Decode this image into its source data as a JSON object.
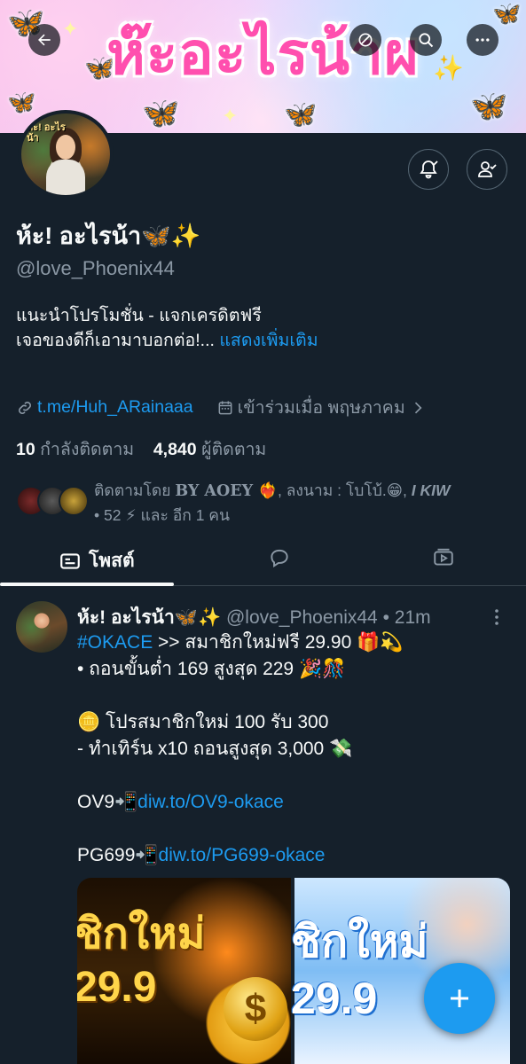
{
  "banner": {
    "title": "ห๊ะอะไรน้าผ"
  },
  "header_buttons": {
    "back": "back-arrow",
    "search": "search",
    "more": "more-dots"
  },
  "profile": {
    "avatar_text": "ห้ะ! อะไรน้า",
    "display_name": "ห้ะ! อะไรน้า🦋✨",
    "handle": "@love_Phoenix44",
    "bio_line1": "แนะนำโปรโมชั่น - แจกเครดิตฟรี",
    "bio_line2": "เจอของดีก็เอามาบอกต่อ!...",
    "show_more": "แสดงเพิ่มเติม",
    "link": "t.me/Huh_ARainaaa",
    "joined": "เข้าร่วมเมื่อ พฤษภาคม",
    "following_count": "10",
    "following_label": "กำลังติดตาม",
    "followers_count": "4,840",
    "followers_label": "ผู้ติดตาม",
    "followed_by_prefix": "ติดตามโดย",
    "followed_by_name1": "BY AOEY ❤️‍🔥",
    "followed_by_sep1": ", ลงนาม : โบโบ้.😁",
    "followed_by_sep2": ", ",
    "followed_by_name3": "I KIW",
    "followed_by_line2a": "• 52 ⚡",
    "followed_by_line2b": " และ อีก 1 คน"
  },
  "tabs": {
    "posts_label": "โพสต์"
  },
  "post": {
    "author": "ห้ะ! อะไรน้า🦋✨",
    "handle": "@love_Phoenix44",
    "time": "• 21m",
    "hashtag": "#OKACE",
    "line1_rest": " >> สมาชิกใหม่ฟรี 29.90 🎁💫",
    "line2": "• ถอนขั้นต่ำ 169 สูงสุด 229 🎉🎊",
    "line3": "🪙 โปรสมาชิกใหม่ 100 รับ 300",
    "line4": " - ทำเทิร์น x10 ถอนสูงสุด 3,000 💸",
    "ov9_label": "OV9📲",
    "ov9_link": "diw.to/OV9-okace",
    "pg699_label": "PG699📲",
    "pg699_link": "diw.to/PG699-okace",
    "media_left_line1": "ชิกใหม่",
    "media_left_line2": "29.9",
    "media_right_line1": "ชิกใหม่",
    "media_right_line2": "29.9",
    "coin_symbol": "$"
  },
  "colors": {
    "background": "#15202b",
    "accent": "#1d9bf0",
    "secondary_text": "#8b98a5"
  }
}
